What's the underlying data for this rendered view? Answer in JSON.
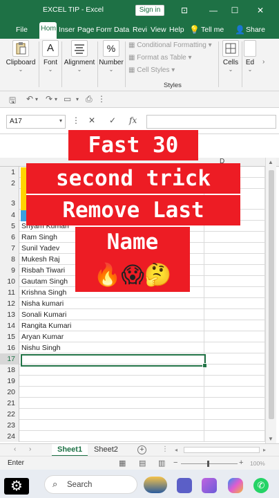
{
  "window": {
    "title": "EXCEL TIP  -  Excel",
    "signin": "Sign in",
    "min": "—",
    "restore": "☐",
    "close": "✕",
    "coauthor": "⊡"
  },
  "ribbon_tabs": [
    "File",
    "Hom",
    "Inser",
    "Page",
    "Form",
    "Data",
    "Revi",
    "View",
    "Help",
    "Tell me",
    "Share"
  ],
  "ribbon": {
    "clipboard": "Clipboard",
    "font": "Font",
    "alignment": "Alignment",
    "number": "Number",
    "conditional_formatting": "Conditional Formatting",
    "format_as_table": "Format as Table",
    "cell_styles": "Cell Styles",
    "styles_group": "Styles",
    "cells": "Cells",
    "editing": "Ed",
    "font_icon": "A",
    "number_icon": "%"
  },
  "formula_bar": {
    "name_box": "A17",
    "fx": "fx",
    "cancel": "✕",
    "enter": "✓",
    "formula": ""
  },
  "columns": {
    "d": "D"
  },
  "rows": [
    {
      "num": "1",
      "a": ""
    },
    {
      "num": "2",
      "a": ""
    },
    {
      "num": "3",
      "a": ""
    },
    {
      "num": "4",
      "a": ""
    },
    {
      "num": "5",
      "a": "Shyam Kumari"
    },
    {
      "num": "6",
      "a": "Ram Singh"
    },
    {
      "num": "7",
      "a": "Sunil Yadev"
    },
    {
      "num": "8",
      "a": "Mukesh Raj"
    },
    {
      "num": "9",
      "a": "Risbah Tiwari"
    },
    {
      "num": "10",
      "a": "Gautam Singh"
    },
    {
      "num": "11",
      "a": "Krishna Singh"
    },
    {
      "num": "12",
      "a": "Nisha kumari"
    },
    {
      "num": "13",
      "a": "Sonali Kumari"
    },
    {
      "num": "14",
      "a": "Rangita Kumari"
    },
    {
      "num": "15",
      "a": "Aryan Kumar"
    },
    {
      "num": "16",
      "a": "Nishu Singh"
    },
    {
      "num": "17",
      "a": ""
    },
    {
      "num": "18",
      "a": ""
    },
    {
      "num": "19",
      "a": ""
    },
    {
      "num": "20",
      "a": ""
    },
    {
      "num": "21",
      "a": ""
    },
    {
      "num": "22",
      "a": ""
    },
    {
      "num": "23",
      "a": ""
    },
    {
      "num": "24",
      "a": ""
    }
  ],
  "overlay": {
    "line1": "Fast 30",
    "line2": "second trick",
    "line3": "Remove Last",
    "line4": "Name",
    "emojis": "🔥😱🤔"
  },
  "sheets": {
    "active": "Sheet1",
    "other": "Sheet2",
    "add": "+"
  },
  "status": {
    "mode": "Enter",
    "zoom": "100%"
  },
  "taskbar": {
    "search": "Search"
  }
}
